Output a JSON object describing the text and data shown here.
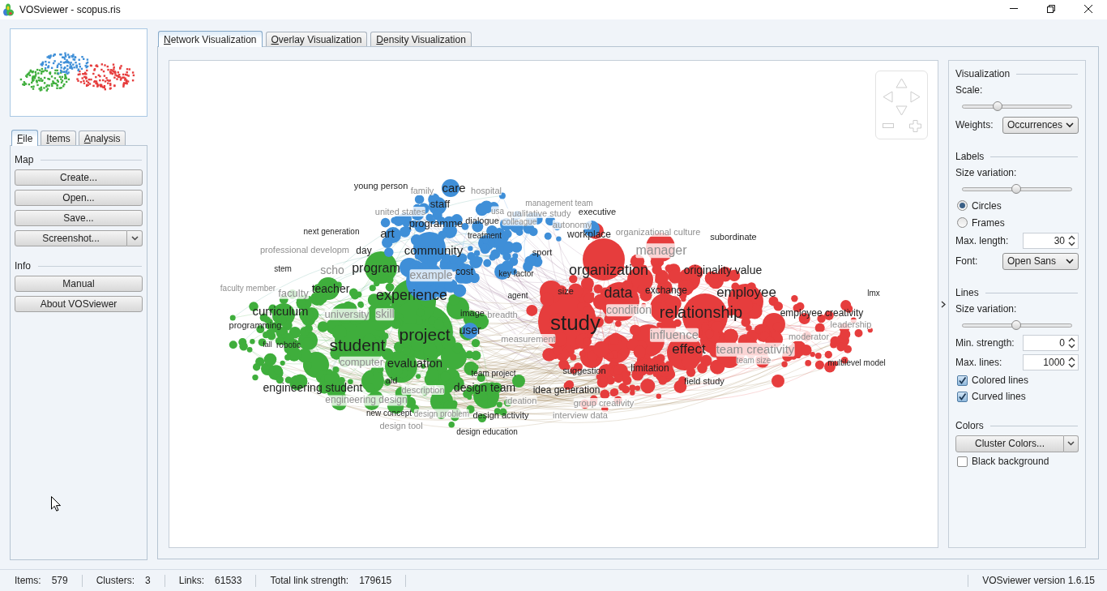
{
  "window": {
    "title": "VOSviewer - scopus.ris"
  },
  "left_panel": {
    "tabs": [
      {
        "label": "File",
        "selected": true
      },
      {
        "label": "Items",
        "selected": false
      },
      {
        "label": "Analysis",
        "selected": false
      }
    ],
    "groups": [
      {
        "title": "Map",
        "buttons": [
          {
            "kind": "button",
            "label": "Create..."
          },
          {
            "kind": "button",
            "label": "Open..."
          },
          {
            "kind": "button",
            "label": "Save..."
          },
          {
            "kind": "split",
            "label": "Screenshot..."
          }
        ]
      },
      {
        "title": "Info",
        "buttons": [
          {
            "kind": "button",
            "label": "Manual"
          },
          {
            "kind": "button",
            "label": "About VOSviewer"
          }
        ]
      }
    ]
  },
  "view_tabs": [
    {
      "label": "Network Visualization",
      "selected": true
    },
    {
      "label": "Overlay Visualization",
      "selected": false
    },
    {
      "label": "Density Visualization",
      "selected": false
    }
  ],
  "network": {
    "clusters": [
      {
        "color": "#e63d3d"
      },
      {
        "color": "#3fae3c"
      },
      {
        "color": "#3f8fd8"
      }
    ],
    "labels": [
      {
        "text": "young person",
        "faded": false
      },
      {
        "text": "family",
        "faded": true
      },
      {
        "text": "care",
        "faded": false
      },
      {
        "text": "hospital",
        "faded": true
      },
      {
        "text": "staff",
        "faded": false
      },
      {
        "text": "management team",
        "faded": true
      },
      {
        "text": "united states",
        "faded": true
      },
      {
        "text": "usa",
        "faded": true
      },
      {
        "text": "qualitative study",
        "faded": true
      },
      {
        "text": "executive",
        "faded": false
      },
      {
        "text": "programme",
        "faded": false
      },
      {
        "text": "dialogue",
        "faded": false
      },
      {
        "text": "colleague",
        "faded": true
      },
      {
        "text": "autonomy",
        "faded": true
      },
      {
        "text": "next generation",
        "faded": false
      },
      {
        "text": "art",
        "faded": false
      },
      {
        "text": "treatment",
        "faded": false
      },
      {
        "text": "workplace",
        "faded": false
      },
      {
        "text": "organizational culture",
        "faded": true
      },
      {
        "text": "subordinate",
        "faded": false
      },
      {
        "text": "professional developm",
        "faded": true
      },
      {
        "text": "day",
        "faded": false
      },
      {
        "text": "community",
        "faded": false
      },
      {
        "text": "sport",
        "faded": false
      },
      {
        "text": "manager",
        "faded": true
      },
      {
        "text": "stem",
        "faded": false
      },
      {
        "text": "scho",
        "faded": true
      },
      {
        "text": "program",
        "faded": false
      },
      {
        "text": "example",
        "faded": true
      },
      {
        "text": "cost",
        "faded": false
      },
      {
        "text": "key factor",
        "faded": false
      },
      {
        "text": "organization",
        "faded": false
      },
      {
        "text": "originality value",
        "faded": false
      },
      {
        "text": "faculty member",
        "faded": true
      },
      {
        "text": "faculty",
        "faded": true
      },
      {
        "text": "teacher",
        "faded": false
      },
      {
        "text": "experience",
        "faded": false
      },
      {
        "text": "agent",
        "faded": false
      },
      {
        "text": "size",
        "faded": false
      },
      {
        "text": "data",
        "faded": false
      },
      {
        "text": "exchange",
        "faded": false
      },
      {
        "text": "employee",
        "faded": false
      },
      {
        "text": "lmx",
        "faded": false
      },
      {
        "text": "curriculum",
        "faded": false
      },
      {
        "text": "university",
        "faded": true
      },
      {
        "text": "skill",
        "faded": true
      },
      {
        "text": "image",
        "faded": false
      },
      {
        "text": "breadth",
        "faded": true
      },
      {
        "text": "condition",
        "faded": true
      },
      {
        "text": "relationship",
        "faded": false
      },
      {
        "text": "employee creativity",
        "faded": false
      },
      {
        "text": "programming",
        "faded": false
      },
      {
        "text": "study",
        "faded": false
      },
      {
        "text": "leadership",
        "faded": true
      },
      {
        "text": "project",
        "faded": false
      },
      {
        "text": "user",
        "faded": false
      },
      {
        "text": "measurement",
        "faded": true
      },
      {
        "text": "influence",
        "faded": true
      },
      {
        "text": "moderator",
        "faded": true
      },
      {
        "text": "fall",
        "faded": false
      },
      {
        "text": "robotic",
        "faded": false
      },
      {
        "text": "student",
        "faded": false
      },
      {
        "text": "effect",
        "faded": false
      },
      {
        "text": "team creativity",
        "faded": true
      },
      {
        "text": "computer",
        "faded": true
      },
      {
        "text": "evaluation",
        "faded": false
      },
      {
        "text": "team size",
        "faded": true
      },
      {
        "text": "multilevel model",
        "faded": false
      },
      {
        "text": "team project",
        "faded": false
      },
      {
        "text": "suggestion",
        "faded": false
      },
      {
        "text": "limitation",
        "faded": false
      },
      {
        "text": "aid",
        "faded": false
      },
      {
        "text": "field study",
        "faded": false
      },
      {
        "text": "engineering student",
        "faded": false
      },
      {
        "text": "description",
        "faded": true
      },
      {
        "text": "design team",
        "faded": false
      },
      {
        "text": "idea generation",
        "faded": false
      },
      {
        "text": "engineering design",
        "faded": true
      },
      {
        "text": "ideation",
        "faded": true
      },
      {
        "text": "group creativity",
        "faded": true
      },
      {
        "text": "new concept",
        "faded": false
      },
      {
        "text": "design problem",
        "faded": true
      },
      {
        "text": "design activity",
        "faded": false
      },
      {
        "text": "interview data",
        "faded": true
      },
      {
        "text": "design tool",
        "faded": true
      },
      {
        "text": "design education",
        "faded": false
      }
    ]
  },
  "settings": {
    "sections": [
      {
        "title": "Visualization",
        "controls": [
          {
            "kind": "slider",
            "label": "Scale:",
            "level": 0.32
          },
          {
            "kind": "dropdown",
            "label": "Weights:",
            "value": "Occurrences"
          }
        ]
      },
      {
        "title": "Labels",
        "controls": [
          {
            "kind": "slider",
            "label": "Size variation:",
            "level": 0.49
          },
          {
            "kind": "radio",
            "label": "Circles",
            "selected": true
          },
          {
            "kind": "radio",
            "label": "Frames",
            "selected": false
          },
          {
            "kind": "spinner",
            "label": "Max. length:",
            "value": "30"
          },
          {
            "kind": "dropdown",
            "label": "Font:",
            "value": "Open Sans"
          }
        ]
      },
      {
        "title": "Lines",
        "controls": [
          {
            "kind": "slider",
            "label": "Size variation:",
            "level": 0.49
          },
          {
            "kind": "spinner",
            "label": "Min. strength:",
            "value": "0"
          },
          {
            "kind": "spinner",
            "label": "Max. lines:",
            "value": "1000"
          },
          {
            "kind": "checkbox",
            "label": "Colored lines",
            "checked": true
          },
          {
            "kind": "checkbox",
            "label": "Curved lines",
            "checked": true
          }
        ]
      },
      {
        "title": "Colors",
        "controls": [
          {
            "kind": "split_button",
            "label": "Cluster Colors..."
          },
          {
            "kind": "checkbox",
            "label": "Black background",
            "checked": false
          }
        ]
      }
    ]
  },
  "status_bar": {
    "fields": [
      {
        "label": "Items:",
        "value": "579"
      },
      {
        "label": "Clusters:",
        "value": "3"
      },
      {
        "label": "Links:",
        "value": "61533"
      },
      {
        "label": "Total link strength:",
        "value": "179615"
      }
    ],
    "version": "VOSviewer version 1.6.15"
  }
}
